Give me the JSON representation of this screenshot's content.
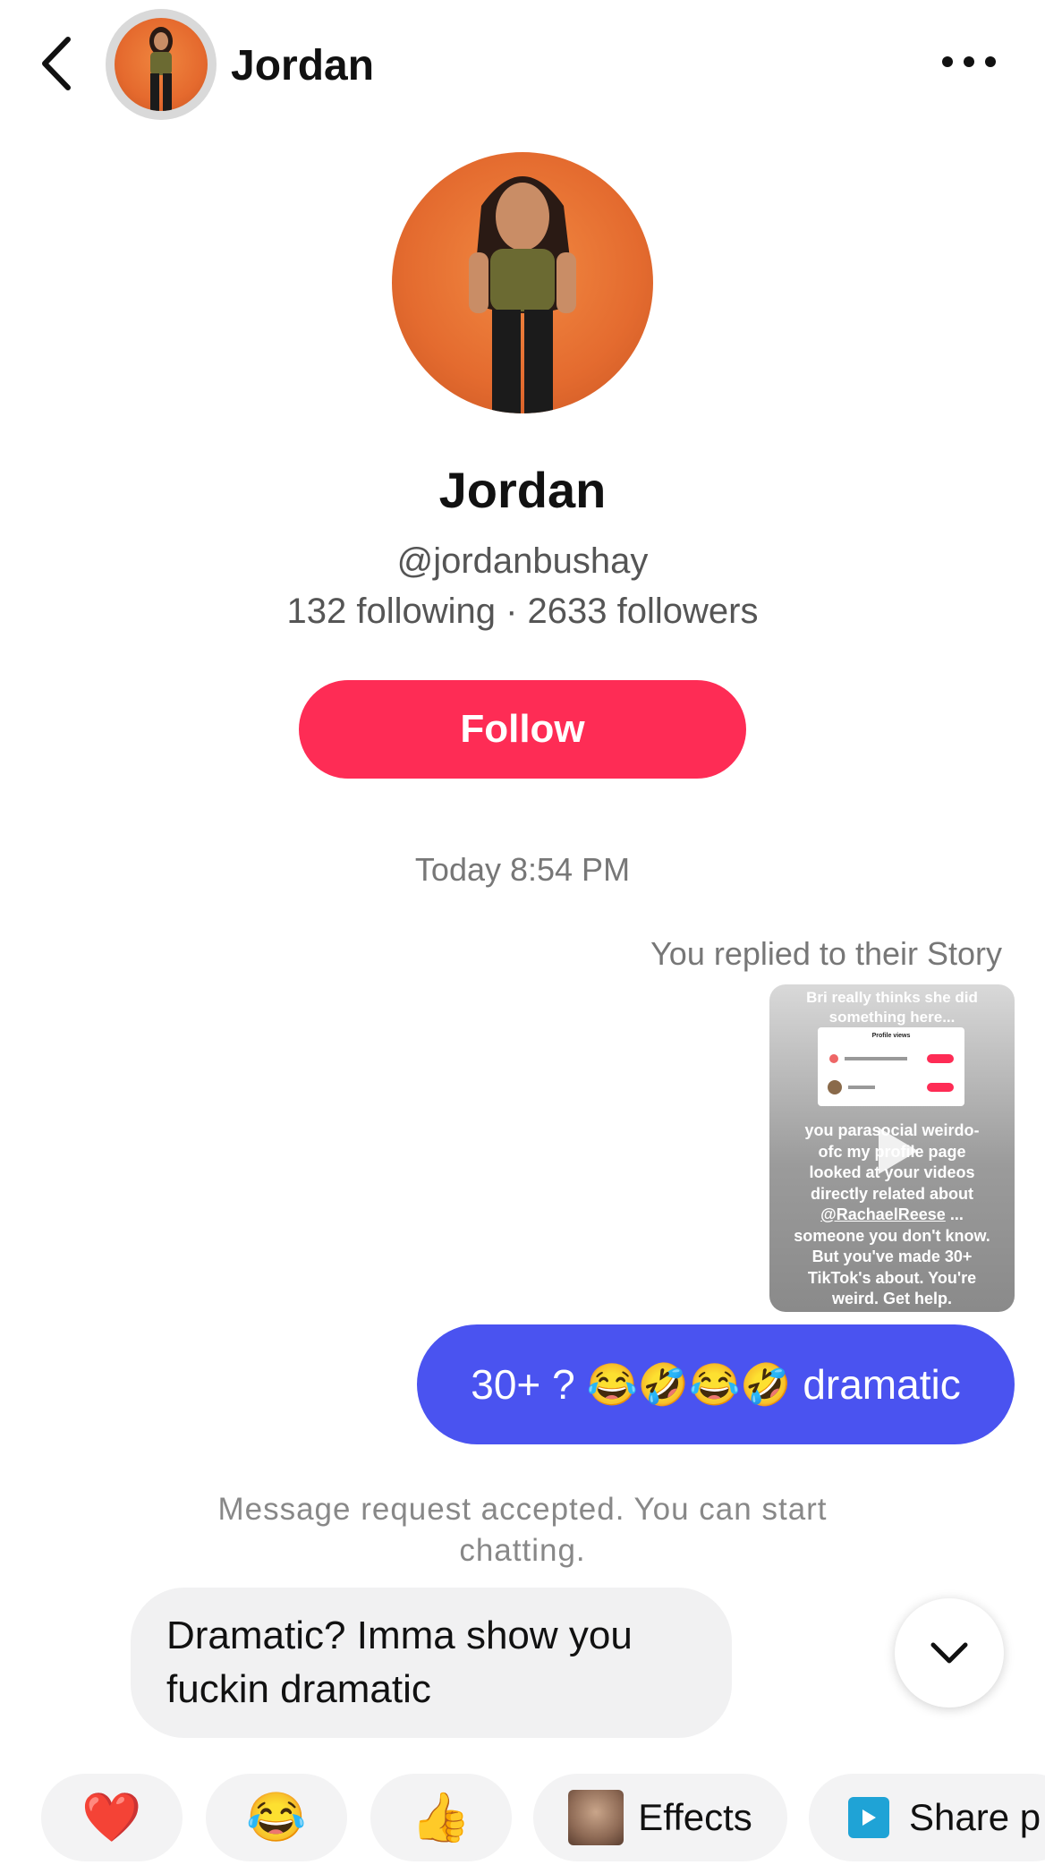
{
  "header": {
    "name": "Jordan"
  },
  "profile": {
    "name": "Jordan",
    "handle": "@jordanbushay",
    "stats": "132 following · 2633 followers",
    "follow_label": "Follow"
  },
  "chat": {
    "timestamp": "Today 8:54 PM",
    "story_note": "You replied to their Story",
    "story": {
      "top_text": "Bri really thinks she did something here...",
      "card_title": "Profile views",
      "body_line1": "you parasocial weirdo-",
      "body_line2": "ofc my profile page",
      "body_line3": "looked at your videos",
      "body_line4": "directly related about",
      "body_mention": "@RachaelReese",
      "body_line6": "someone you don't know.",
      "body_line7": "But you've made 30+",
      "body_line8": "TikTok's about. You're",
      "body_line9": "weird. Get help."
    },
    "sent_message": "30+ ? 😂🤣😂🤣 dramatic",
    "system_note": "Message request accepted. You can start chatting.",
    "received_message": "Dramatic? Imma show you fuckin dramatic"
  },
  "quick_bar": {
    "heart": "❤️",
    "laugh": "😂",
    "thumbs_up": "👍",
    "effects_label": "Effects",
    "share_label": "Share p"
  },
  "colors": {
    "follow": "#fe2c55",
    "sent_bubble": "#4a53f0",
    "received_bubble": "#f1f1f2"
  }
}
